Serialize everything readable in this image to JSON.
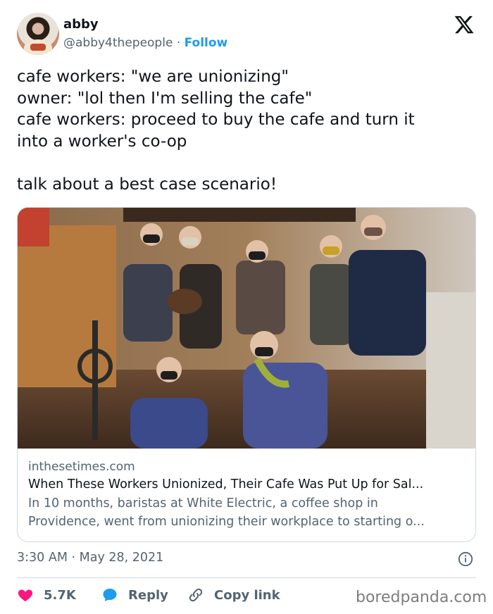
{
  "author": {
    "name": "abby",
    "handle": "@abby4thepeople",
    "separator": "·",
    "follow_label": "Follow",
    "avatar_icon": "profile-photo"
  },
  "platform_icon": "x-logo-icon",
  "tweet": {
    "text": "cafe workers: \"we are unionizing\"\nowner: \"lol then I'm selling the cafe\"\ncafe workers: proceed to buy the cafe and turn it\ninto a worker's co-op\n\ntalk about a best case scenario!"
  },
  "link_card": {
    "image_description_icon": "group-photo",
    "domain": "inthesetimes.com",
    "title": "When These Workers Unionized, Their Cafe Was Put Up for Sal...",
    "description_line1": "In 10 months, baristas at White Electric, a coffee shop in",
    "description_line2": "Providence, went from unionizing their workplace to starting o..."
  },
  "meta": {
    "timestamp": "3:30 AM · May 28, 2021"
  },
  "actions": {
    "like_count": "5.7K",
    "reply_label": "Reply",
    "copy_label": "Copy link"
  },
  "watermark": "boredpanda.com",
  "colors": {
    "accent": "#1d9bf0",
    "heart": "#f91880",
    "text_secondary": "#536471",
    "border": "#cfd9de"
  }
}
